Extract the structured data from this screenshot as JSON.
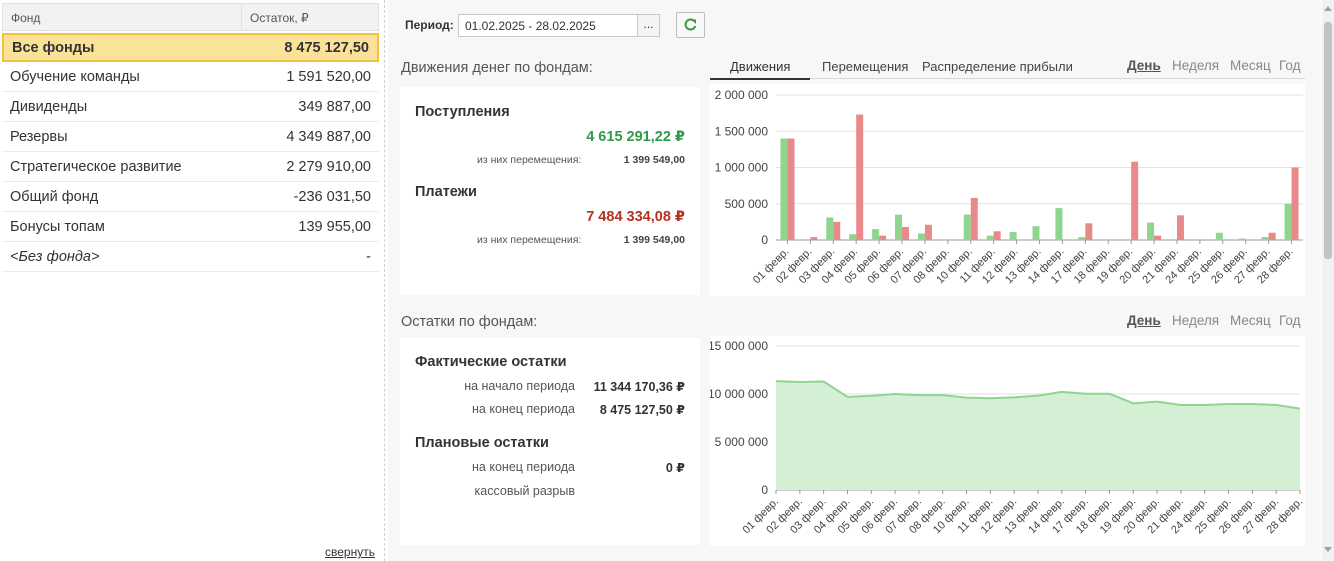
{
  "funds_table": {
    "col_name": "Фонд",
    "col_balance": "Остаток, ₽",
    "rows": [
      {
        "name": "Все фонды",
        "value": "8 475 127,50"
      },
      {
        "name": "Обучение команды",
        "value": "1 591 520,00"
      },
      {
        "name": "Дивиденды",
        "value": "349 887,00"
      },
      {
        "name": "Резервы",
        "value": "4 349 887,00"
      },
      {
        "name": "Стратегическое развитие",
        "value": "2 279 910,00"
      },
      {
        "name": "Общий фонд",
        "value": "-236 031,50"
      },
      {
        "name": "Бонусы топам",
        "value": "139 955,00"
      },
      {
        "name": "<Без фонда>",
        "value": "-"
      }
    ],
    "collapse_label": "свернуть"
  },
  "period": {
    "label": "Период:",
    "value": "01.02.2025 - 28.02.2025",
    "select_btn": "..."
  },
  "movements": {
    "title": "Движения денег по фондам:",
    "income_label": "Поступления",
    "income_value": "4 615 291,22 ₽",
    "income_transfers_label": "из них перемещения:",
    "income_transfers_value": "1 399 549,00",
    "payments_label": "Платежи",
    "payments_value": "7 484 334,08 ₽",
    "payments_transfers_label": "из них перемещения:",
    "payments_transfers_value": "1 399 549,00",
    "tabs": [
      "Движения",
      "Перемещения",
      "Распределение прибыли"
    ],
    "granularity": [
      "День",
      "Неделя",
      "Месяц",
      "Год"
    ]
  },
  "balances": {
    "title": "Остатки по фондам:",
    "actual_label": "Фактические остатки",
    "start_label": "на начало периода",
    "start_value": "11 344 170,36 ₽",
    "end_label": "на конец периода",
    "end_value": "8 475 127,50 ₽",
    "plan_label": "Плановые остатки",
    "plan_end_label": "на конец периода",
    "plan_end_value": "0 ₽",
    "gap_label": "кассовый разрыв",
    "granularity": [
      "День",
      "Неделя",
      "Месяц",
      "Год"
    ]
  },
  "colors": {
    "income": "#8fd58f",
    "payments": "#e88a8a",
    "area": "#d4efd4",
    "area_line": "#8fd58f",
    "income_text": "#2e9a4a",
    "payments_text": "#b5321e"
  },
  "chart_data": [
    {
      "type": "bar",
      "categories": [
        "01 февр.",
        "02 февр.",
        "03 февр.",
        "04 февр.",
        "05 февр.",
        "06 февр.",
        "07 февр.",
        "08 февр.",
        "10 февр.",
        "11 февр.",
        "12 февр.",
        "13 февр.",
        "14 февр.",
        "17 февр.",
        "18 февр.",
        "19 февр.",
        "20 февр.",
        "21 февр.",
        "24 февр.",
        "25 февр.",
        "26 февр.",
        "27 февр.",
        "28 февр."
      ],
      "series": [
        {
          "values": [
            1400000,
            0,
            310000,
            80000,
            150000,
            350000,
            90000,
            0,
            350000,
            60000,
            110000,
            190000,
            440000,
            40000,
            0,
            0,
            240000,
            0,
            0,
            100000,
            20000,
            40000,
            500000
          ]
        },
        {
          "values": [
            1400000,
            40000,
            250000,
            1730000,
            60000,
            180000,
            210000,
            0,
            580000,
            120000,
            0,
            0,
            0,
            230000,
            0,
            1080000,
            60000,
            340000,
            0,
            0,
            0,
            100000,
            1000000
          ]
        }
      ],
      "yticks": [
        "0",
        "500 000",
        "1 000 000",
        "1 500 000",
        "2 000 000"
      ],
      "ylim": [
        0,
        2000000
      ]
    },
    {
      "type": "area",
      "categories": [
        "01 февр.",
        "02 февр.",
        "03 февр.",
        "04 февр.",
        "05 февр.",
        "06 февр.",
        "07 февр.",
        "08 февр.",
        "10 февр.",
        "11 февр.",
        "12 февр.",
        "13 февр.",
        "14 февр.",
        "17 февр.",
        "18 февр.",
        "19 февр.",
        "20 февр.",
        "21 февр.",
        "24 февр.",
        "25 февр.",
        "26 февр.",
        "27 февр.",
        "28 февр."
      ],
      "values": [
        11340000,
        11250000,
        11300000,
        9700000,
        9800000,
        10000000,
        9880000,
        9880000,
        9620000,
        9560000,
        9650000,
        9830000,
        10220000,
        10030000,
        10030000,
        9030000,
        9200000,
        8860000,
        8860000,
        8960000,
        8960000,
        8860000,
        8475000
      ],
      "yticks": [
        "0",
        "5 000 000",
        "10 000 000",
        "15 000 000"
      ],
      "ylim": [
        0,
        15000000
      ]
    }
  ]
}
